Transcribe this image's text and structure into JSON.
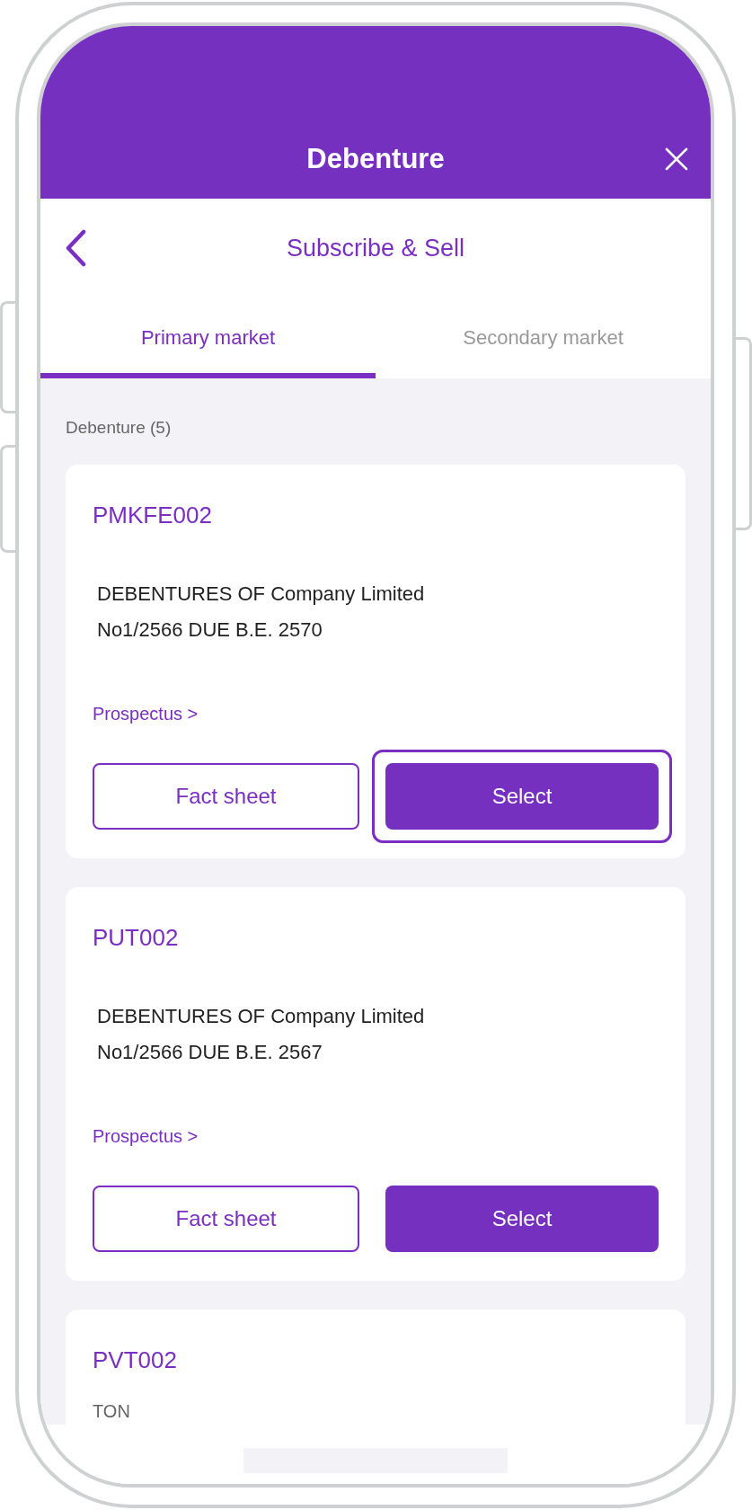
{
  "header": {
    "title": "Debenture"
  },
  "subheader": {
    "title": "Subscribe & Sell"
  },
  "tabs": [
    {
      "label": "Primary market",
      "selected": true
    },
    {
      "label": "Secondary market",
      "selected": false
    }
  ],
  "list_heading": "Debenture (5)",
  "cards": [
    {
      "code": "PMKFE002",
      "description_lines": [
        "DEBENTURES OF Company Limited",
        "No1/2566 DUE B.E. 2570"
      ],
      "link": "Prospectus >",
      "fact_sheet": {
        "label": "Fact sheet"
      },
      "select": {
        "label": "Select",
        "focused": true
      }
    },
    {
      "code": "PUT002",
      "description_lines": [
        "DEBENTURES OF Company Limited",
        "No1/2566 DUE B.E. 2567"
      ],
      "link": "Prospectus >",
      "fact_sheet": {
        "label": "Fact sheet"
      },
      "select": {
        "label": "Select",
        "focused": false
      }
    },
    {
      "code": "PVT002",
      "subtitle": "TON"
    }
  ]
}
